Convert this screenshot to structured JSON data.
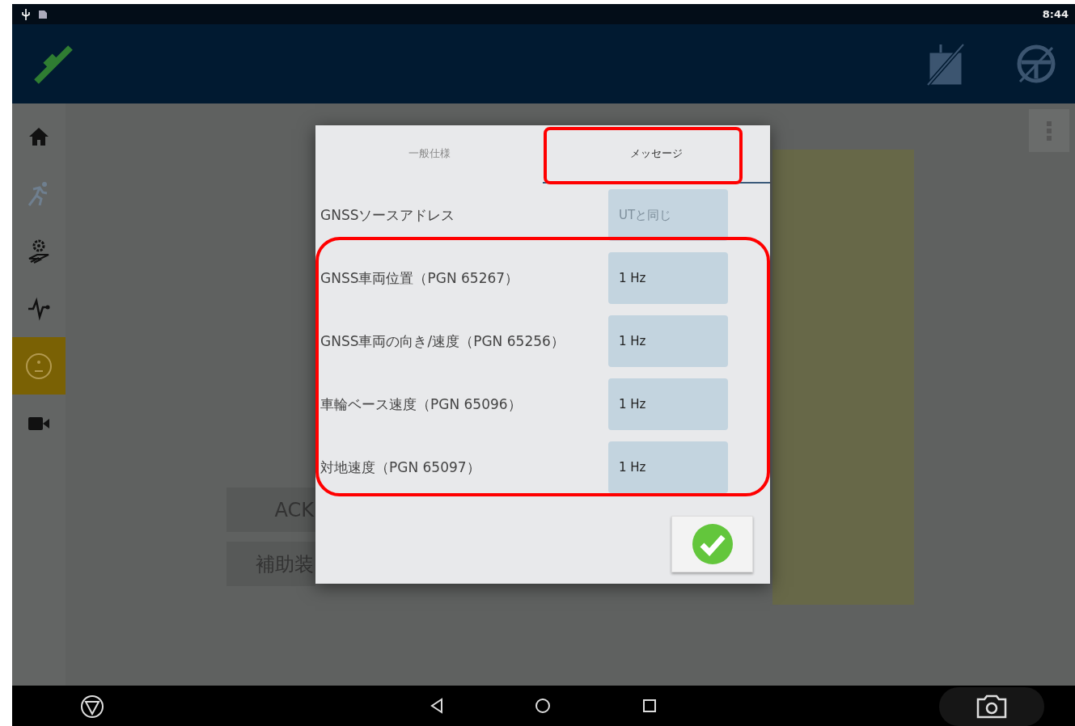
{
  "status_bar": {
    "time": "8:44"
  },
  "sidebar": {
    "items": [
      {
        "kind": "home",
        "selected": false,
        "disabled": false
      },
      {
        "kind": "runner",
        "selected": false,
        "disabled": true
      },
      {
        "kind": "field",
        "selected": false,
        "disabled": false
      },
      {
        "kind": "pulse",
        "selected": false,
        "disabled": false
      },
      {
        "kind": "badge",
        "selected": true,
        "disabled": false
      },
      {
        "kind": "video",
        "selected": false,
        "disabled": false
      }
    ]
  },
  "background_buttons": [
    "ACK",
    "補助装"
  ],
  "dialog": {
    "tabs": [
      {
        "label": "一般仕様",
        "selected": false
      },
      {
        "label": "メッセージ",
        "selected": true
      }
    ],
    "rows": [
      {
        "label": "GNSSソースアドレス",
        "value": "UTと同じ",
        "disabled": true
      },
      {
        "label": "GNSS車両位置（PGN 65267）",
        "value": "1 Hz",
        "disabled": false
      },
      {
        "label": "GNSS車両の向き/速度（PGN 65256）",
        "value": "1 Hz",
        "disabled": false
      },
      {
        "label": "車輪ベース速度（PGN 65096）",
        "value": "1 Hz",
        "disabled": false
      },
      {
        "label": "対地速度（PGN 65097）",
        "value": "1 Hz",
        "disabled": false
      }
    ]
  }
}
